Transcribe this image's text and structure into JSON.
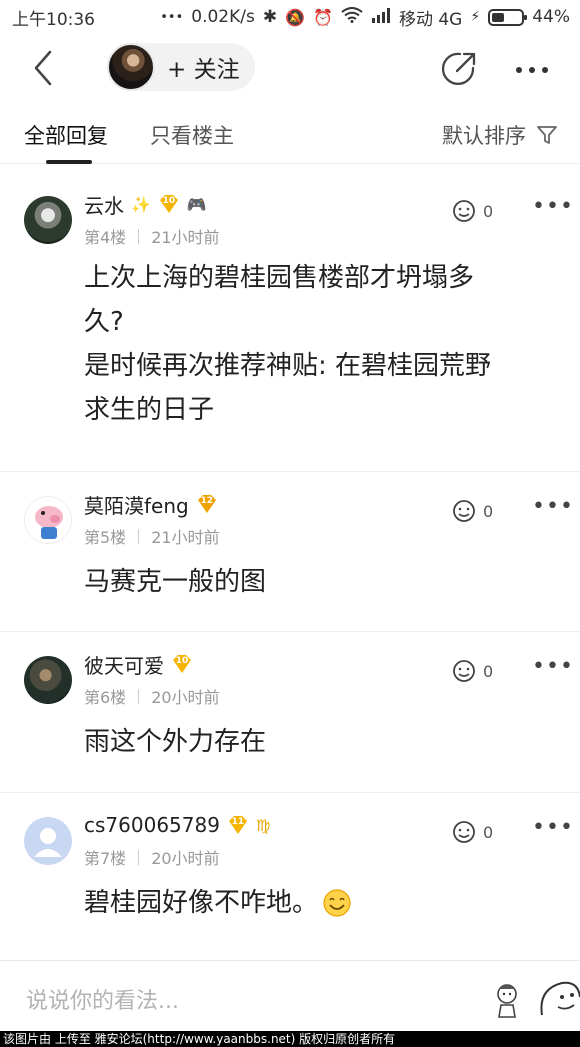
{
  "status_bar": {
    "time": "上午10:36",
    "dots": "•••",
    "speed": "0.02K/s",
    "network": "移动 4G",
    "battery": "44%",
    "battery_level": 0.44
  },
  "header": {
    "follow_label": "+ 关注"
  },
  "tabs": {
    "all": "全部回复",
    "op_only": "只看楼主",
    "sort": "默认排序"
  },
  "comments": [
    {
      "name": "云水",
      "level": "10",
      "floor": "第4楼",
      "time": "21小时前",
      "likes": "0",
      "text_lines": [
        "上次上海的碧桂园售楼部才坍塌多",
        "久?",
        "是时候再次推荐神贴: 在碧桂园荒野",
        "求生的日子"
      ]
    },
    {
      "name": "莫陌漠feng",
      "level": "12",
      "floor": "第5楼",
      "time": "21小时前",
      "likes": "0",
      "text_lines": [
        "马赛克一般的图"
      ]
    },
    {
      "name": "彼天可爱",
      "level": "10",
      "floor": "第6楼",
      "time": "20小时前",
      "likes": "0",
      "text_lines": [
        "雨这个外力存在"
      ]
    },
    {
      "name": "cs760065789",
      "level": "11",
      "zodiac": "♍",
      "floor": "第7楼",
      "time": "20小时前",
      "likes": "0",
      "text_lines": [
        "碧桂园好像不咋地。"
      ]
    }
  ],
  "input": {
    "placeholder": "说说你的看法..."
  },
  "watermark": "该图片由  上传至 雅安论坛(http://www.yaanbbs.net) 版权归原创者所有",
  "colors": {
    "badge_gold": "#f5b400",
    "badge_orange": "#f0a200",
    "zodiac": "#e6a800"
  }
}
